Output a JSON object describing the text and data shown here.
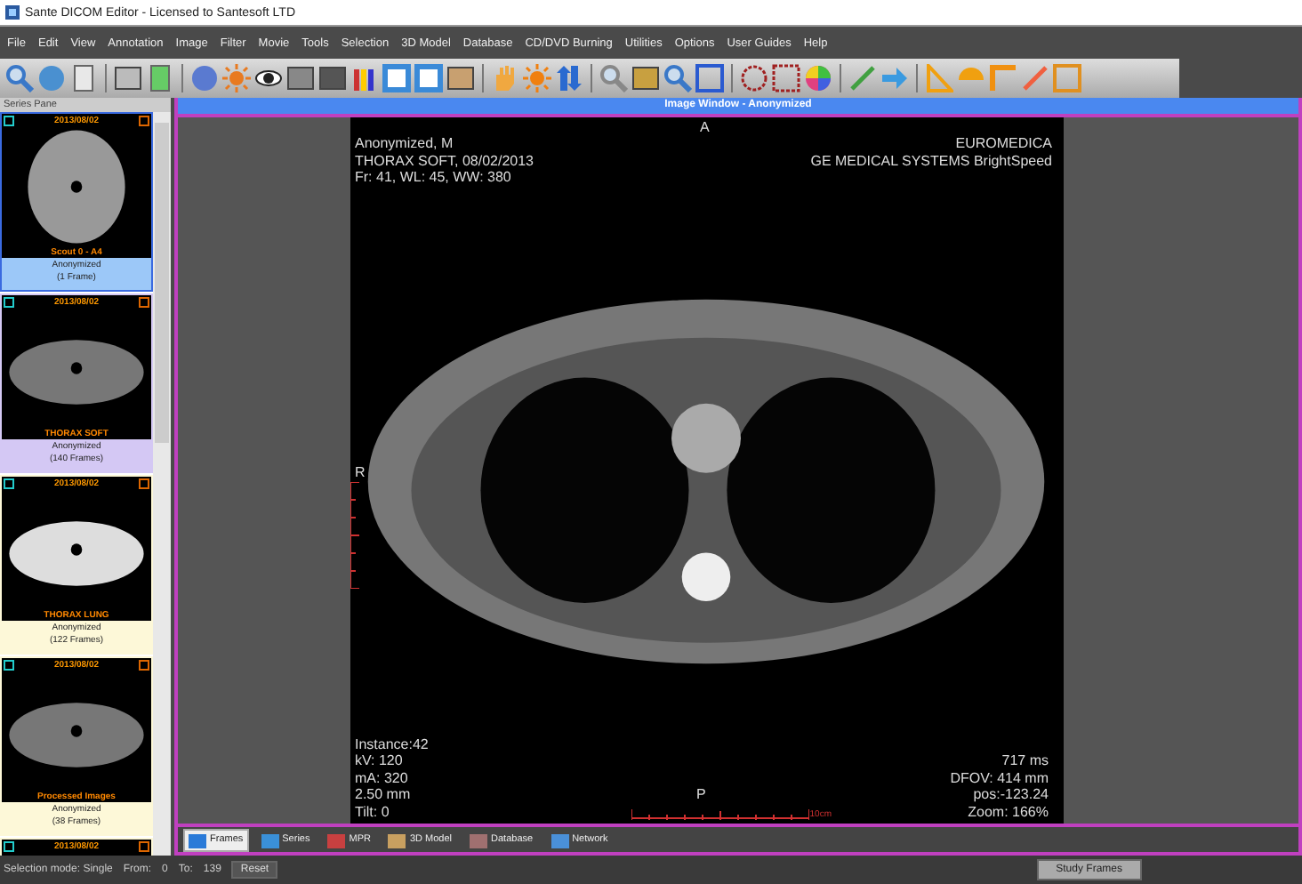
{
  "window": {
    "title": "Sante DICOM Editor - Licensed to Santesoft LTD"
  },
  "menu": [
    "File",
    "Edit",
    "View",
    "Annotation",
    "Image",
    "Filter",
    "Movie",
    "Tools",
    "Selection",
    "3D Model",
    "Database",
    "CD/DVD Burning",
    "Utilities",
    "Options",
    "User Guides",
    "Help"
  ],
  "series_pane": {
    "title": "Series Pane",
    "series": [
      {
        "date": "2013/08/02",
        "name": "Scout   0 - A4",
        "patient": "Anonymized",
        "frames": "(1 Frame)",
        "color": "#9cc8f8",
        "selected": true
      },
      {
        "date": "2013/08/02",
        "name": "THORAX SOFT",
        "patient": "Anonymized",
        "frames": "(140 Frames)",
        "color": "#d4c8f4",
        "selected": false
      },
      {
        "date": "2013/08/02",
        "name": "THORAX LUNG",
        "patient": "Anonymized",
        "frames": "(122 Frames)",
        "color": "#fdf8d8",
        "selected": false
      },
      {
        "date": "2013/08/02",
        "name": "Processed Images",
        "patient": "Anonymized",
        "frames": "(38 Frames)",
        "color": "#fdf8d8",
        "selected": false
      },
      {
        "date": "2013/08/02",
        "color": "#fdf8d8",
        "selected": false
      }
    ]
  },
  "image_window": {
    "title": "Image Window - Anonymized",
    "top_left": [
      "Anonymized, M",
      "THORAX SOFT, 08/02/2013",
      "Fr: 41, WL: 45, WW: 380"
    ],
    "top_right": [
      "EUROMEDICA",
      "GE MEDICAL SYSTEMS BrightSpeed"
    ],
    "bottom_left": [
      "Instance:42",
      "kV: 120",
      "mA: 320",
      "2.50 mm",
      "Tilt: 0"
    ],
    "bottom_right": [
      "717 ms",
      "DFOV: 414 mm",
      "pos:-123.24",
      "Zoom: 166%"
    ],
    "orientation_top": "A",
    "orientation_left": "R",
    "orientation_bottom": "P",
    "scale_label": "10cm"
  },
  "bottom_tabs": [
    {
      "label": "Frames",
      "selected": true
    },
    {
      "label": "Series",
      "selected": false
    },
    {
      "label": "MPR",
      "selected": false
    },
    {
      "label": "3D Model",
      "selected": false
    },
    {
      "label": "Database",
      "selected": false
    },
    {
      "label": "Network",
      "selected": false
    }
  ],
  "status_bar": {
    "selection_mode": "Selection mode: Single",
    "from": "From:",
    "from_value": "0",
    "to": "To:",
    "to_value": "139",
    "reset": "Reset",
    "study_frames": "Study Frames"
  }
}
